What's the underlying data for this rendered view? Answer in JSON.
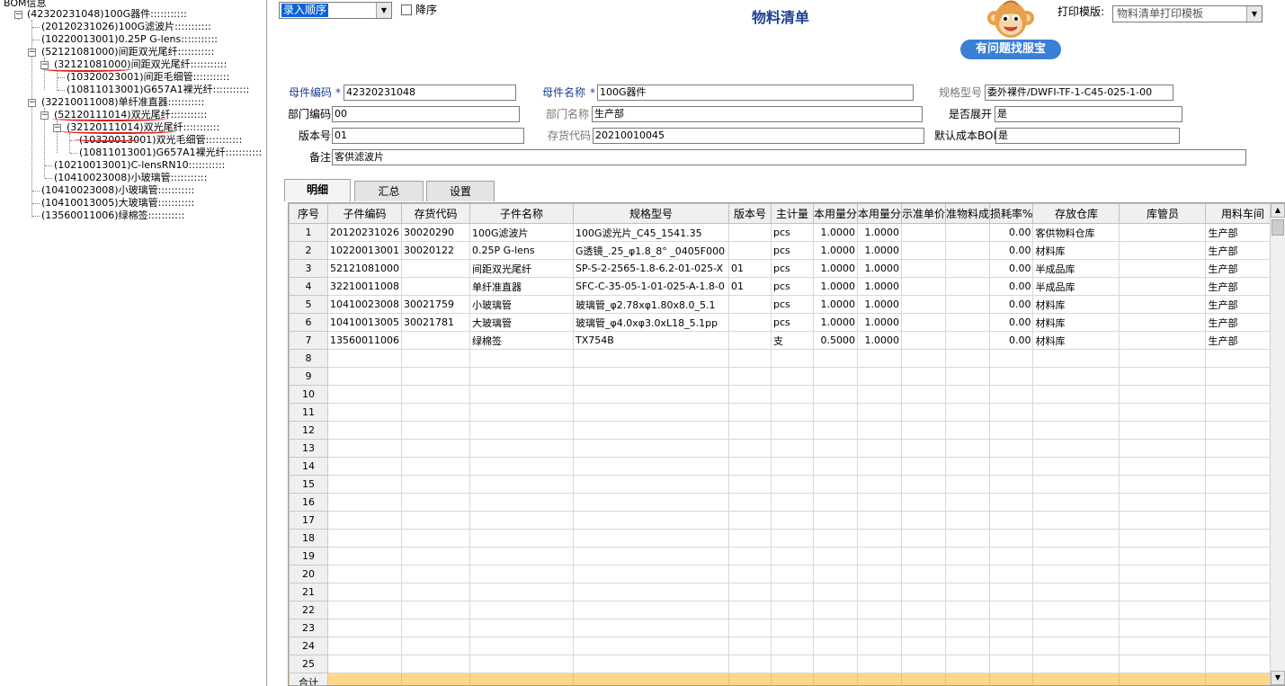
{
  "tree": {
    "root": "BOM信息",
    "nodes": [
      {
        "label": "(42320231048)100G器件:::::::::::"
      },
      {
        "label": "(20120231026)100G滤波片:::::::::::"
      },
      {
        "label": "(10220013001)0.25P G-lens:::::::::::"
      },
      {
        "label": "(52121081000)间距双光尾纤:::::::::::"
      },
      {
        "label": "(32121081000)间距双光尾纤:::::::::::"
      },
      {
        "label": "(10320023001)间距毛细管:::::::::::"
      },
      {
        "label": "(10811013001)G657A1裸光纤:::::::::::"
      },
      {
        "label": "(32210011008)单纤准直器:::::::::::"
      },
      {
        "label": "(52120111014)双光尾纤:::::::::::"
      },
      {
        "label": "(32120111014)双光尾纤:::::::::::"
      },
      {
        "label": "(10320013001)双光毛细管:::::::::::"
      },
      {
        "label": "(10811013001)G657A1裸光纤:::::::::::"
      },
      {
        "label": "(10210013001)C-lensRN10:::::::::::"
      },
      {
        "label": "(10410023008)小玻璃管:::::::::::"
      },
      {
        "label": "(10410023008)小玻璃管:::::::::::"
      },
      {
        "label": "(10410013005)大玻璃管:::::::::::"
      },
      {
        "label": "(13560011006)绿棉签:::::::::::"
      }
    ]
  },
  "toolbar": {
    "sort_value": "录入顺序",
    "desc_label": "降序",
    "print_label": "打印模版:",
    "print_value": "物料清单打印模板"
  },
  "title": "物料清单",
  "help_button": "有问题找服宝",
  "form": {
    "parent_code_label": "母件编码",
    "parent_code": "42320231048",
    "parent_name_label": "母件名称",
    "parent_name": "100G器件",
    "spec_label": "规格型号",
    "spec": "委外裸件/DWFI-TF-1-C45-025-1-00",
    "dept_code_label": "部门编码",
    "dept_code": "00",
    "dept_name_label": "部门名称",
    "dept_name": "生产部",
    "expand_label": "是否展开",
    "expand": "是",
    "version_label": "版本号",
    "version": "01",
    "inv_code_label": "存货代码",
    "inv_code": "20210010045",
    "default_bom_label": "默认成本BOM",
    "default_bom": "是",
    "remark_label": "备注",
    "remark": "客供滤波片"
  },
  "tabs": [
    "明细",
    "汇总",
    "设置"
  ],
  "grid": {
    "headers": [
      "序号",
      "子件编码",
      "存货代码",
      "子件名称",
      "规格型号",
      "版本号",
      "主计量",
      "本用量分",
      "本用量分",
      "示准单价",
      "准物料成",
      "损耗率%",
      "存放仓库",
      "库管员",
      "用料车间"
    ],
    "rows": [
      [
        "1",
        "20120231026",
        "30020290",
        "100G滤波片",
        "100G滤光片_C45_1541.35",
        "",
        "pcs",
        "1.0000",
        "1.0000",
        "",
        "",
        "0.00",
        "客供物料仓库",
        "",
        "生产部"
      ],
      [
        "2",
        "10220013001",
        "30020122",
        "0.25P G-lens",
        "G透镜_.25_φ1.8_8° _0405F000",
        "",
        "pcs",
        "1.0000",
        "1.0000",
        "",
        "",
        "0.00",
        "材料库",
        "",
        "生产部"
      ],
      [
        "3",
        "52121081000",
        "",
        "间距双光尾纤",
        "SP-S-2-2565-1.8-6.2-01-025-X",
        "01",
        "pcs",
        "1.0000",
        "1.0000",
        "",
        "",
        "0.00",
        "半成品库",
        "",
        "生产部"
      ],
      [
        "4",
        "32210011008",
        "",
        "单纤准直器",
        "SFC-C-35-05-1-01-025-A-1.8-0",
        "01",
        "pcs",
        "1.0000",
        "1.0000",
        "",
        "",
        "0.00",
        "半成品库",
        "",
        "生产部"
      ],
      [
        "5",
        "10410023008",
        "30021759",
        "小玻璃管",
        "玻璃管_φ2.78xφ1.80x8.0_5.1",
        "",
        "pcs",
        "1.0000",
        "1.0000",
        "",
        "",
        "0.00",
        "材料库",
        "",
        "生产部"
      ],
      [
        "6",
        "10410013005",
        "30021781",
        "大玻璃管",
        "玻璃管_φ4.0xφ3.0xL18_5.1pp",
        "",
        "pcs",
        "1.0000",
        "1.0000",
        "",
        "",
        "0.00",
        "材料库",
        "",
        "生产部"
      ],
      [
        "7",
        "13560011006",
        "",
        "绿棉签",
        "TX754B",
        "",
        "支",
        "0.5000",
        "1.0000",
        "",
        "",
        "0.00",
        "材料库",
        "",
        "生产部"
      ]
    ],
    "empty_rows": [
      "8",
      "9",
      "10",
      "11",
      "12",
      "13",
      "14",
      "15",
      "16",
      "17",
      "18",
      "19",
      "20",
      "21",
      "22",
      "23",
      "24",
      "25"
    ],
    "sum_label": "合计"
  }
}
